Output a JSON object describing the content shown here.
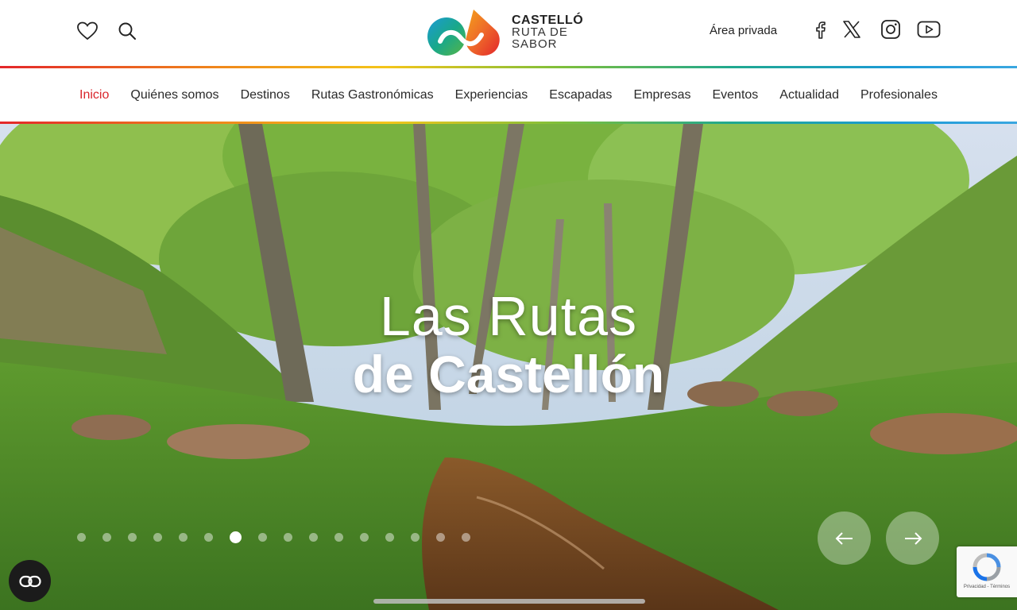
{
  "header": {
    "logo": {
      "line1": "CASTELLÓ",
      "line2": "RUTA DE",
      "line3": "SABOR"
    },
    "private_area": "Área privada",
    "icons": {
      "favorites": "heart-icon",
      "search": "search-icon"
    },
    "social": [
      "facebook-icon",
      "x-icon",
      "instagram-icon",
      "youtube-icon"
    ]
  },
  "nav": {
    "items": [
      {
        "label": "Inicio",
        "active": true
      },
      {
        "label": "Quiénes somos"
      },
      {
        "label": "Destinos"
      },
      {
        "label": "Rutas Gastronómicas"
      },
      {
        "label": "Experiencias"
      },
      {
        "label": "Escapadas"
      },
      {
        "label": "Empresas"
      },
      {
        "label": "Eventos"
      },
      {
        "label": "Actualidad"
      },
      {
        "label": "Profesionales"
      }
    ]
  },
  "hero": {
    "title_line1": "Las Rutas",
    "title_line2": "de Castellón",
    "slides_total": 16,
    "active_slide": 7
  },
  "recaptcha": {
    "text": "Privacidad - Términos"
  },
  "colors": {
    "accent": "#d9262c",
    "nav_text": "#2a2a2a"
  }
}
